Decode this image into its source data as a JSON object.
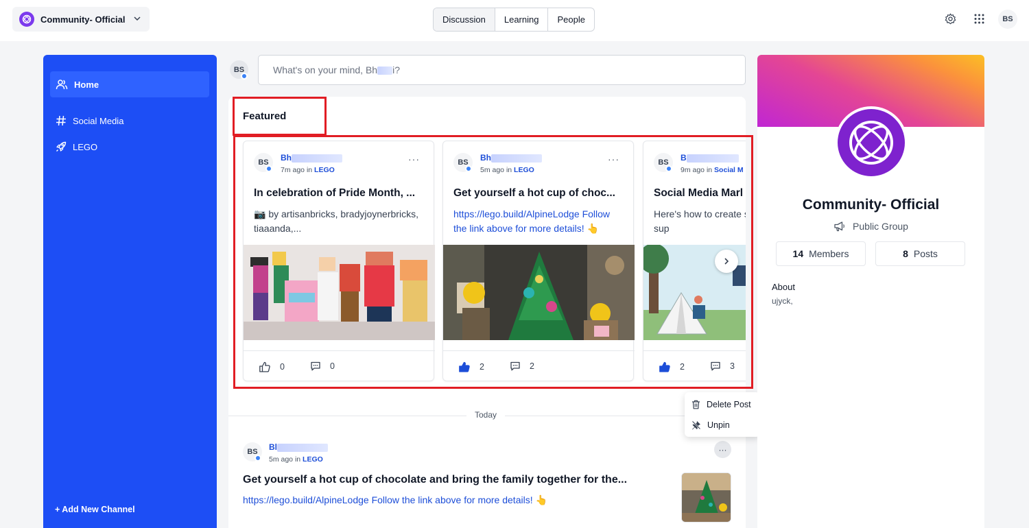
{
  "header": {
    "community_name": "Community- Official",
    "tabs": [
      {
        "label": "Discussion"
      },
      {
        "label": "Learning"
      },
      {
        "label": "People"
      }
    ],
    "user_initials": "BS",
    "icons": [
      "settings-icon",
      "apps-grid-icon"
    ]
  },
  "sidebar": {
    "items": [
      {
        "label": "Home",
        "icon": "users-icon"
      },
      {
        "label": "Social Media",
        "icon": "hash-icon"
      },
      {
        "label": "LEGO",
        "icon": "rocket-icon"
      }
    ],
    "add_channel": "+ Add New Channel"
  },
  "composer": {
    "avatar": "BS",
    "placeholder_start": "What's on your mind, Bh",
    "placeholder_end": "i?"
  },
  "featured": {
    "title": "Featured",
    "cards": [
      {
        "avatar": "BS",
        "author": "Bh",
        "time": "7m ago in",
        "channel": "LEGO",
        "title": "In celebration of Pride Month, ...",
        "body": "📷 by artisanbricks, bradyjoynerbricks, tiaaanda,...",
        "likes": "0",
        "comments": "0",
        "liked": false
      },
      {
        "avatar": "BS",
        "author": "Bh",
        "time": "5m ago in",
        "channel": "LEGO",
        "title": "Get yourself a hot cup of choc...",
        "body": "https://lego.build/AlpineLodge Follow the link above for more details! 👆",
        "likes": "2",
        "comments": "2",
        "liked": true
      },
      {
        "avatar": "BS",
        "author": "B",
        "time": "9m ago in",
        "channel": "Social M",
        "title": "Social Media Marl",
        "body": "Here's how to create strategy that will sup",
        "likes": "2",
        "comments": "3",
        "liked": true
      }
    ]
  },
  "divider": {
    "label": "Today"
  },
  "menu": {
    "items": [
      {
        "label": "Delete Post",
        "icon": "trash-icon"
      },
      {
        "label": "Unpin",
        "icon": "unpin-icon"
      }
    ]
  },
  "post": {
    "avatar": "BS",
    "author": "Bl",
    "time": "5m ago in",
    "channel": "LEGO",
    "title": "Get yourself a hot cup of chocolate and bring the family together for the...",
    "body": "https://lego.build/AlpineLodge Follow the link above for more details! 👆"
  },
  "community": {
    "name": "Community- Official",
    "type": "Public Group",
    "members_count": "14",
    "members_label": "Members",
    "posts_count": "8",
    "posts_label": "Posts",
    "about_label": "About",
    "about_text": "ujyck,"
  },
  "colors": {
    "sidebar": "#1d4ef5",
    "accent": "#1d4ed8",
    "highlight_border": "#e11d24",
    "brand_purple": "#7e22ce"
  }
}
